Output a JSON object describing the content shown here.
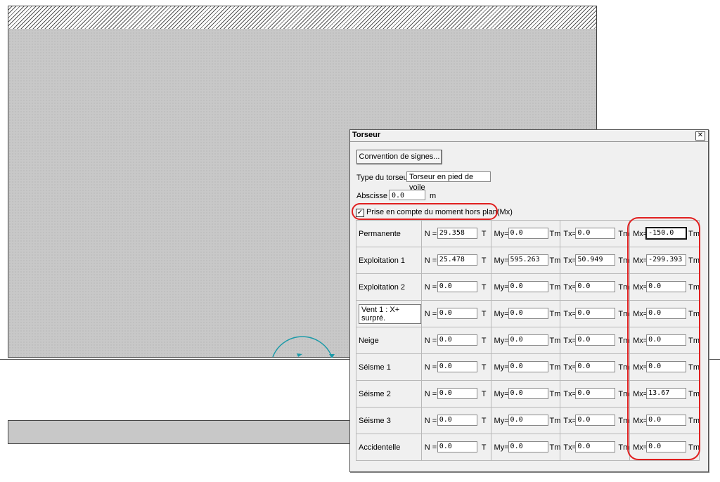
{
  "dialog": {
    "title": "Torseur",
    "close": "✕",
    "convention_button": "Convention de signes...",
    "type_label": "Type du torseur :",
    "type_value": "Torseur en pied de voile",
    "abscisse_label": "Abscisse =",
    "abscisse_value": "0.0",
    "abscisse_unit": "m",
    "checkbox_checked_glyph": "✓",
    "checkbox_label": "Prise en compte du moment hors plan(Mx)"
  },
  "labels": {
    "N": "N =",
    "My": "My=",
    "Tx": "Tx=",
    "Mx": "Mx=",
    "unit_T": "T",
    "unit_Tm": "Tm"
  },
  "rows": [
    {
      "name": "Permanente",
      "N": "29.358",
      "My": "0.0",
      "Tx": "0.0",
      "Mx": "-150.0"
    },
    {
      "name": "Exploitation 1",
      "N": "25.478",
      "My": "595.263",
      "Tx": "50.949",
      "Mx": "-299.393"
    },
    {
      "name": "Exploitation 2",
      "N": "0.0",
      "My": "0.0",
      "Tx": "0.0",
      "Mx": "0.0"
    },
    {
      "name": "Vent 1 : X+ surpré.",
      "N": "0.0",
      "My": "0.0",
      "Tx": "0.0",
      "Mx": "0.0"
    },
    {
      "name": "Neige",
      "N": "0.0",
      "My": "0.0",
      "Tx": "0.0",
      "Mx": "0.0"
    },
    {
      "name": "Séisme 1",
      "N": "0.0",
      "My": "0.0",
      "Tx": "0.0",
      "Mx": "0.0"
    },
    {
      "name": "Séisme 2",
      "N": "0.0",
      "My": "0.0",
      "Tx": "0.0",
      "Mx": "13.67"
    },
    {
      "name": "Séisme 3",
      "N": "0.0",
      "My": "0.0",
      "Tx": "0.0",
      "Mx": "0.0"
    },
    {
      "name": "Accidentelle",
      "N": "0.0",
      "My": "0.0",
      "Tx": "0.0",
      "Mx": "0.0"
    }
  ],
  "colors": {
    "highlight": "#e02020",
    "moment_arc": "#1a9aa8",
    "wall_fill": "#c8c8c8"
  }
}
